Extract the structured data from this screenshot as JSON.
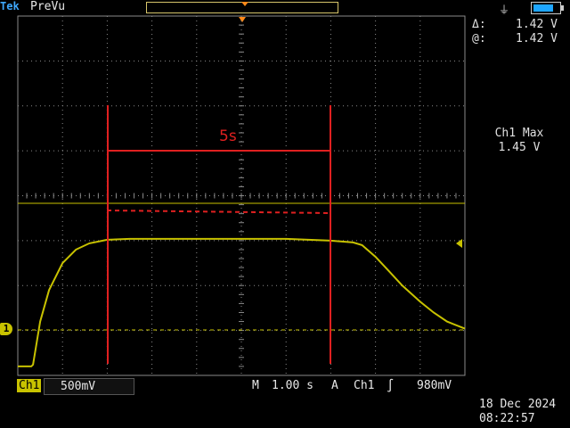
{
  "header": {
    "brand": "Tek",
    "mode": "PreVu"
  },
  "cursor_readout": {
    "delta_label": "Δ:",
    "delta_value": "1.42 V",
    "at_label": "@:",
    "at_value": "1.42 V"
  },
  "measurement": {
    "title": "Ch1 Max",
    "value": "1.45 V"
  },
  "annotation": {
    "label": "5s"
  },
  "channel": {
    "marker": "1",
    "name": "Ch1",
    "scale": "500mV"
  },
  "timebase": {
    "label": "M",
    "value": "1.00 s"
  },
  "trigger": {
    "label": "A",
    "source": "Ch1",
    "level": "980mV"
  },
  "datetime": {
    "date": "18 Dec  2024",
    "time": "08:22:57"
  },
  "colors": {
    "trace": "#c8c200",
    "annotation": "#e02020",
    "grid": "#8a8a8a",
    "trigger_marker": "#ff8a1a"
  },
  "icons": [
    "plug-icon",
    "battery-icon",
    "rising-slope-icon"
  ],
  "chart_data": {
    "type": "line",
    "xlabel": "",
    "ylabel": "",
    "x_unit": "s",
    "y_unit": "V",
    "x_per_div": 1.0,
    "y_per_div": 0.5,
    "xlim": [
      0,
      10
    ],
    "ylim": [
      -0.1,
      3.9
    ],
    "grid": true,
    "series": [
      {
        "x": [
          0,
          0.3,
          0.34,
          0.5,
          0.7,
          1.0,
          1.3,
          1.6,
          2.0,
          2.5,
          3.0,
          3.5,
          4.0,
          4.5,
          5.0,
          5.5,
          6.0,
          6.5,
          7.0,
          7.5,
          7.7,
          8.0,
          8.3,
          8.6,
          9.0,
          9.3,
          9.6,
          10.0
        ],
        "y": [
          0.0,
          0.0,
          0.02,
          0.5,
          0.85,
          1.15,
          1.3,
          1.37,
          1.41,
          1.42,
          1.42,
          1.42,
          1.42,
          1.42,
          1.42,
          1.42,
          1.42,
          1.41,
          1.4,
          1.38,
          1.35,
          1.22,
          1.06,
          0.9,
          0.72,
          0.6,
          0.5,
          0.42
        ]
      }
    ]
  }
}
